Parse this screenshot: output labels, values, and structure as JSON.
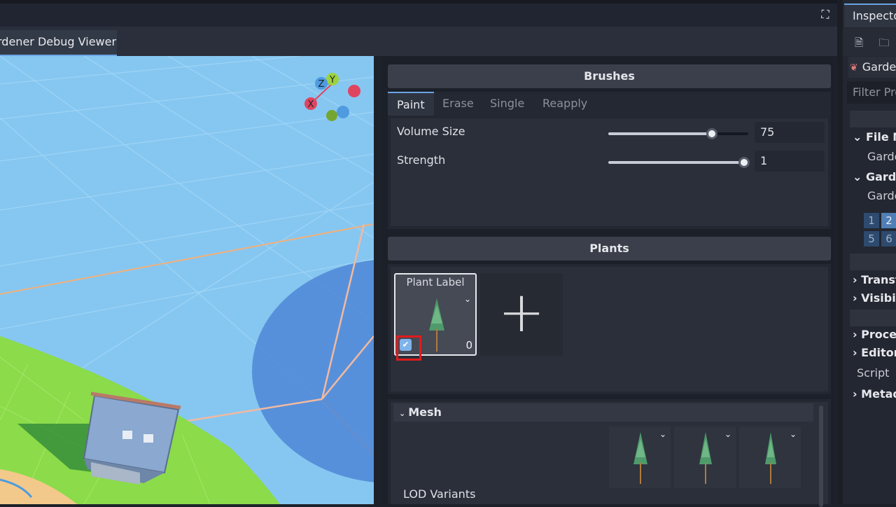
{
  "header": {
    "fullscreen_icon": "fullscreen-icon",
    "viewer_tab_label": "rdener Debug Viewer"
  },
  "viewport": {
    "gizmo_labels": {
      "x": "X",
      "y": "Y",
      "z": "Z"
    },
    "colors": {
      "sky": "#86c7f1",
      "ground": "#8bdb4a",
      "x": "#e0455f",
      "y": "#9ed23c",
      "z": "#4e9be0"
    }
  },
  "brushes": {
    "title": "Brushes",
    "tabs": [
      "Paint",
      "Erase",
      "Single",
      "Reapply"
    ],
    "active_tab": "Paint",
    "volume_size_label": "Volume Size",
    "volume_size_value": "75",
    "volume_size_fraction": 0.74,
    "strength_label": "Strength",
    "strength_value": "1",
    "strength_fraction": 0.97
  },
  "plants": {
    "title": "Plants",
    "card_label": "Plant Label",
    "card_count": "0",
    "card_checked": true,
    "add_button_glyph": "+"
  },
  "mesh": {
    "title": "Mesh",
    "lod_label": "LOD Variants"
  },
  "inspector": {
    "tab_label": "Inspector",
    "node_name": "Gardener",
    "filter_placeholder": "Filter Properties",
    "sections": {
      "file_m": "File M",
      "garde_sub1": "Garde",
      "garde": "Garde",
      "garde_sub2": "Garde",
      "transf": "Transf",
      "visibil": "Visibil",
      "proces": "Proces",
      "editor": "Editor",
      "script": "Script",
      "metad": "Metad"
    },
    "layers": [
      "1",
      "2",
      "5",
      "6"
    ]
  }
}
